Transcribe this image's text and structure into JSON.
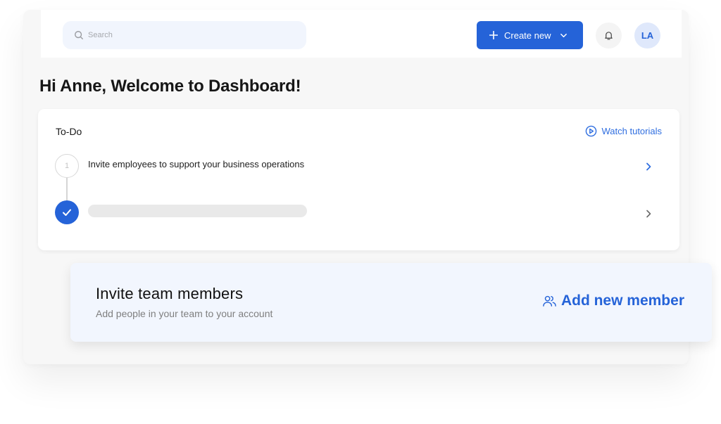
{
  "header": {
    "search": {
      "placeholder": "Search",
      "icon": "search-icon"
    },
    "create_button": {
      "label": "Create new",
      "icon": "plus-icon",
      "dropdown_icon": "chevron-down-icon"
    },
    "notifications": {
      "icon": "bell-icon"
    },
    "avatar": {
      "initials": "LA"
    }
  },
  "page": {
    "title": "Hi Anne, Welcome to Dashboard!"
  },
  "todo": {
    "title": "To-Do",
    "watch_tutorials": {
      "label": "Watch tutorials",
      "icon": "play-circle-icon"
    },
    "steps": [
      {
        "number": "1",
        "label": "Invite employees to support your business operations",
        "state": "pending"
      },
      {
        "number": "",
        "label": "",
        "state": "completed"
      }
    ]
  },
  "invite": {
    "title": "Invite team members",
    "subtitle": "Add people in your team to your account",
    "action": {
      "label": "Add new member",
      "icon": "users-icon"
    }
  },
  "colors": {
    "accent": "#2563d8",
    "link": "#2f6ee0",
    "search_bg": "#f1f5fd",
    "invite_bg": "#f2f6fe",
    "avatar_bg": "#dfe8fb",
    "skeleton": "#e9e9e9"
  }
}
